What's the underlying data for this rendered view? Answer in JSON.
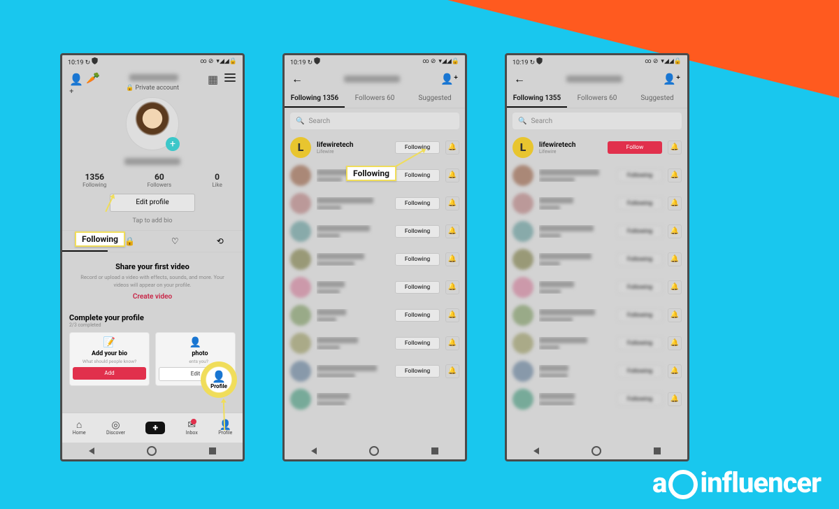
{
  "brand": "influencer",
  "status": {
    "time": "10:19",
    "sync": "↻",
    "extra": "∞ ⊘",
    "signal": "▾◢◢🔒"
  },
  "screen1": {
    "private_label": "Private account",
    "stats": [
      {
        "n": "1356",
        "l": "Following"
      },
      {
        "n": "60",
        "l": "Followers"
      },
      {
        "n": "0",
        "l": "Like"
      }
    ],
    "edit_profile": "Edit profile",
    "tap_bio": "Tap to add bio",
    "share": {
      "title": "Share your first video",
      "desc": "Record or upload a video with effects, sounds, and more. Your videos will appear on your profile.",
      "cta": "Create video"
    },
    "complete": {
      "title": "Complete your profile",
      "sub": "2/3 completed"
    },
    "cards": [
      {
        "icon": "✎",
        "title": "Add your bio",
        "sub": "What should people know?",
        "btn": "Add"
      },
      {
        "icon": "👤",
        "title_suffix": "photo",
        "sub_suffix": "ents you?",
        "btn": "Edit"
      }
    ],
    "nav": [
      {
        "l": "Home"
      },
      {
        "l": "Discover"
      },
      {
        "l": "Post"
      },
      {
        "l": "Inbox"
      },
      {
        "l": "Profile"
      }
    ],
    "callout_following": "Following",
    "callout_profile": "Profile"
  },
  "screen2": {
    "tabs": [
      {
        "l": "Following 1356",
        "active": true
      },
      {
        "l": "Followers 60"
      },
      {
        "l": "Suggested"
      }
    ],
    "search_ph": "Search",
    "rows": [
      {
        "name": "lifewiretech",
        "sub": "Lifewire",
        "btn": "Following",
        "av": "L"
      },
      {
        "btn": "Following"
      },
      {
        "btn": "Following"
      },
      {
        "btn": "Following"
      },
      {
        "btn": "Following"
      },
      {
        "btn": "Following"
      },
      {
        "btn": "Following"
      },
      {
        "btn": "Following"
      },
      {
        "btn": "Following"
      },
      {}
    ],
    "callout": "Following"
  },
  "screen3": {
    "tabs": [
      {
        "l": "Following 1355",
        "active": true
      },
      {
        "l": "Followers 60"
      },
      {
        "l": "Suggested"
      }
    ],
    "search_ph": "Search",
    "rows": [
      {
        "name": "lifewiretech",
        "sub": "Lifewire",
        "btn": "Follow",
        "red": true,
        "av": "L"
      },
      {},
      {},
      {},
      {},
      {},
      {},
      {},
      {},
      {}
    ]
  }
}
